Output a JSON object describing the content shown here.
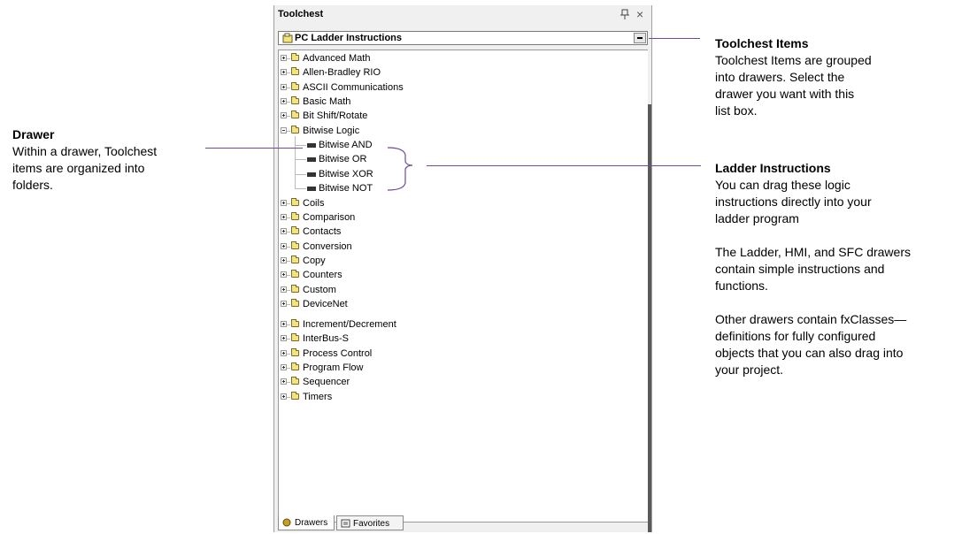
{
  "panel": {
    "title": "Toolchest",
    "combo_value": "PC Ladder Instructions",
    "tabs": [
      "Drawers",
      "Favorites"
    ]
  },
  "tree": {
    "before": [
      "Advanced Math",
      "Allen-Bradley RIO",
      "ASCII Communications",
      "Basic Math",
      "Bit Shift/Rotate"
    ],
    "expanded": "Bitwise Logic",
    "children": [
      "Bitwise AND",
      "Bitwise OR",
      "Bitwise XOR",
      "Bitwise NOT"
    ],
    "after": [
      "Coils",
      "Comparison",
      "Contacts",
      "Conversion",
      "Copy",
      "Counters",
      "Custom",
      "DeviceNet",
      "Increment/Decrement",
      "InterBus-S",
      "Process Control",
      "Program Flow",
      "Sequencer",
      "Timers"
    ]
  },
  "callouts": {
    "drawer": {
      "title": "Drawer",
      "lines": [
        "Within a drawer, Toolchest",
        "items are organized into",
        "folders."
      ]
    },
    "items": {
      "title": "Toolchest Items",
      "lines": [
        "Toolchest Items are grouped",
        "into drawers. Select the",
        "drawer you want with this",
        "list box."
      ]
    },
    "ladder": {
      "title": "Ladder Instructions",
      "lines": [
        "You can drag these logic",
        "instructions directly into your",
        "ladder program"
      ],
      "p2": [
        "The Ladder, HMI, and SFC drawers",
        "contain simple instructions and",
        "functions."
      ],
      "p3": [
        "Other drawers contain fxClasses—",
        "definitions for fully configured",
        "objects that you can also drag into",
        "your project."
      ]
    }
  },
  "colors": {
    "leader_line": "#6f4a96",
    "scrollbar": "#5a5a5a"
  }
}
